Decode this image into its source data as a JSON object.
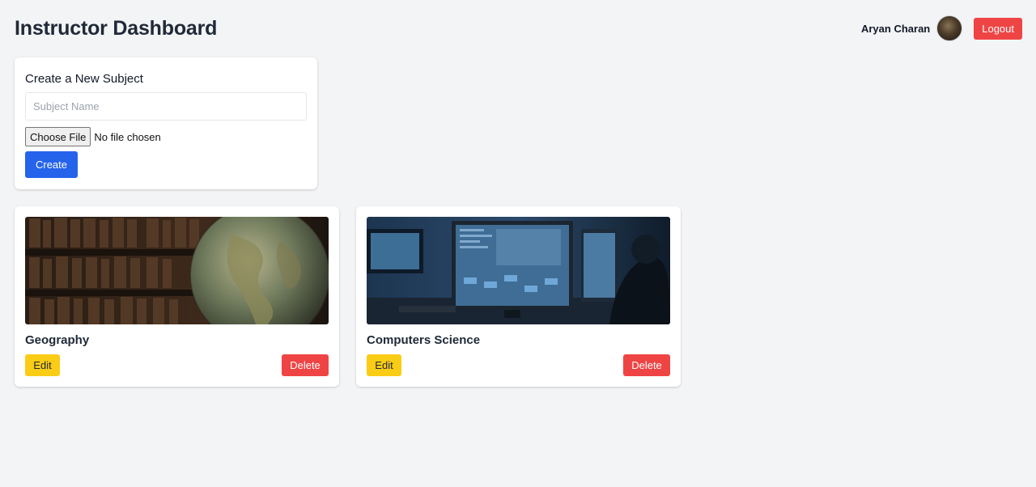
{
  "header": {
    "title": "Instructor Dashboard",
    "user_name": "Aryan Charan",
    "logout_label": "Logout"
  },
  "create_subject": {
    "title": "Create a New Subject",
    "name_placeholder": "Subject Name",
    "name_value": "",
    "choose_file_label": "Choose File",
    "file_status": "No file chosen",
    "create_label": "Create"
  },
  "subjects": [
    {
      "name": "Geography",
      "image": "globe-library-image",
      "edit_label": "Edit",
      "delete_label": "Delete"
    },
    {
      "name": "Computers Science",
      "image": "computer-workstation-image",
      "edit_label": "Edit",
      "delete_label": "Delete"
    }
  ],
  "colors": {
    "background": "#f3f4f6",
    "primary": "#2563eb",
    "danger": "#ef4444",
    "warning": "#facc15"
  }
}
